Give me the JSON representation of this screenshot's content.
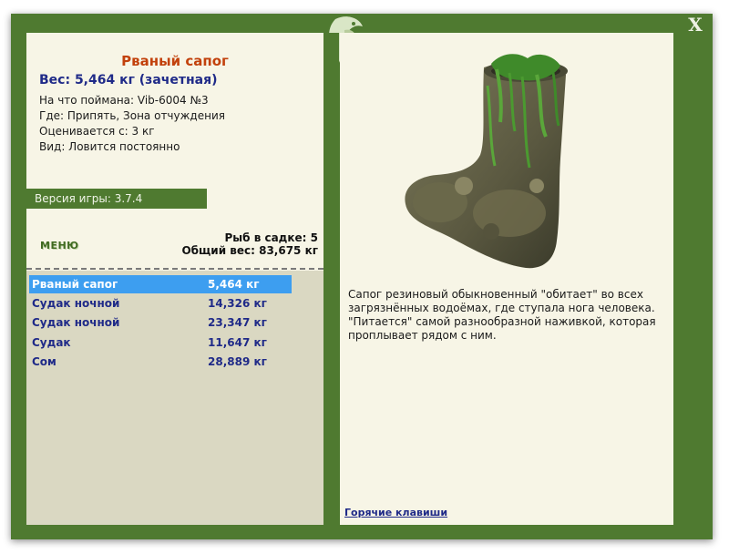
{
  "window": {
    "close_label": "X"
  },
  "fish": {
    "title": "Рваный сапог",
    "weight": "Вес: 5,464 кг (зачетная)",
    "caught_with": "На что поймана: Vib-6004 №3",
    "location": "Где: Припять, Зона отчуждения",
    "rated_from": "Оценивается с: 3 кг",
    "species": "Вид: Ловится постоянно"
  },
  "version": "Версия игры: 3.7.4",
  "menu_label": "МЕНЮ",
  "stats": {
    "fish_in_keepnet": "Рыб в садке: 5",
    "total_weight": "Общий вес: 83,675 кг"
  },
  "catch_list": [
    {
      "name": "Рваный сапог",
      "weight": "5,464 кг",
      "selected": true
    },
    {
      "name": "Судак ночной",
      "weight": "14,326 кг",
      "selected": false
    },
    {
      "name": "Судак ночной",
      "weight": "23,347 кг",
      "selected": false
    },
    {
      "name": "Судак",
      "weight": "11,647 кг",
      "selected": false
    },
    {
      "name": "Сом",
      "weight": "28,889 кг",
      "selected": false
    }
  ],
  "description": "Сапог резиновый обыкновенный \"обитает\" во всех загрязнённых водоёмах, где ступала нога человека. \"Питается\" самой разнообразной наживкой, которая проплывает рядом с ним.",
  "hotkeys_label": "Горячие клавиши",
  "colors": {
    "frame": "#4f7a30",
    "panel": "#f7f5e6",
    "list_bg": "#dad8c2",
    "selected": "#3d9ef0",
    "title": "#c2410c",
    "text_blue": "#1f2a88"
  },
  "icons": {
    "emblem": "fish-emblem-icon",
    "close": "close-icon"
  }
}
